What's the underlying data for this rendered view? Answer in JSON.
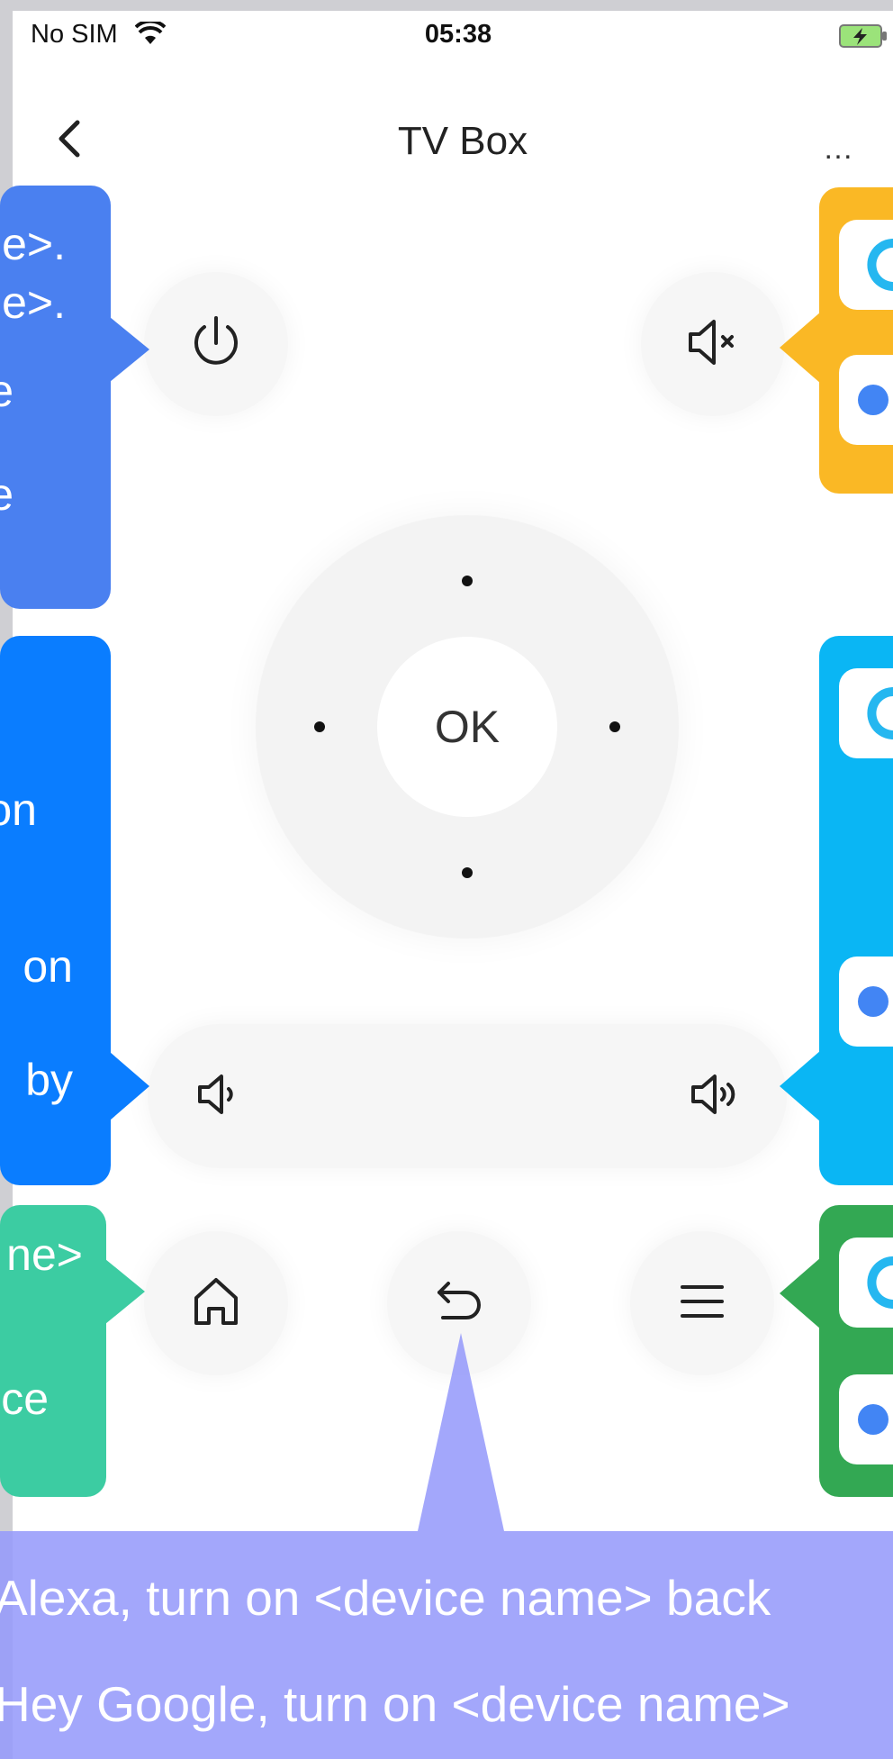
{
  "status_bar": {
    "carrier": "No SIM",
    "time": "05:38"
  },
  "nav": {
    "title": "TV Box",
    "more": "…"
  },
  "dpad": {
    "ok_label": "OK"
  },
  "colors": {
    "power_callout": "#4a80f0",
    "mute_callout": "#fab825",
    "volume_callout": "#0a7dff",
    "dpad_callout": "#0ab6f4",
    "home_callout": "#3ccca2",
    "menu_callout": "#33a853",
    "banner": "#969bfa"
  },
  "callouts": {
    "power": [
      "e>.",
      "e>.",
      "e",
      "e"
    ],
    "volume": [
      "on",
      "on",
      "by"
    ],
    "home": [
      "ne>",
      "ce"
    ]
  },
  "banner": {
    "line1": "Alexa, turn on <device name> back",
    "line2": "Hey Google, turn on <device name>"
  },
  "icons": {
    "power": "power-icon",
    "mute": "mute-icon",
    "volume_down": "volume-down-icon",
    "volume_up": "volume-up-icon",
    "home": "home-icon",
    "back": "back-icon",
    "menu": "menu-icon"
  }
}
